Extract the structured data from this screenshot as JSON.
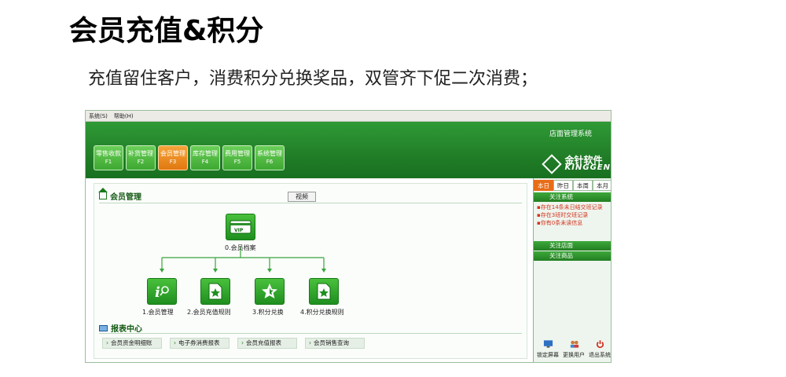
{
  "slide": {
    "title": "会员充值&积分",
    "subtitle": "充值留住客户，消费积分兑换奖品，双管齐下促二次消费；"
  },
  "app": {
    "menu": [
      "系统(S)",
      "帮助(H)"
    ],
    "system_title": "店面管理系统",
    "brand_cn": "金针软件",
    "brand_en": "KINGGEN",
    "nav": [
      {
        "label": "零售收款",
        "key": "F1"
      },
      {
        "label": "补货管理",
        "key": "F2"
      },
      {
        "label": "会员管理",
        "key": "F3"
      },
      {
        "label": "库存管理",
        "key": "F4"
      },
      {
        "label": "费用管理",
        "key": "F5"
      },
      {
        "label": "系统管理",
        "key": "F6"
      }
    ],
    "section_title": "会员管理",
    "video_label": "视频",
    "root_label": "0.会员档案",
    "root_icon_text": "VIP",
    "children": [
      {
        "label": "1.会员管理",
        "icon": "info-search-icon"
      },
      {
        "label": "2.会员充值规则",
        "icon": "star-document-icon"
      },
      {
        "label": "3.积分兑换",
        "icon": "star-icon"
      },
      {
        "label": "4.积分兑换规则",
        "icon": "star-document-icon"
      }
    ],
    "report_title": "报表中心",
    "reports": [
      "会员资金明细账",
      "电子券消费报表",
      "会员充值报表",
      "会员销售查询"
    ]
  },
  "side": {
    "tabs": [
      "本日",
      "昨日",
      "本周",
      "本月"
    ],
    "section1": "关注系统",
    "notices": [
      "▪存在14条未日结交班记录",
      "▪存在3班时交班记录",
      "▪你有0条未读信息"
    ],
    "section2": "关注店面",
    "section3": "关注商品",
    "actions": [
      {
        "label": "锁定屏幕",
        "icon": "lock-screen-icon",
        "color": "#2d6fc4"
      },
      {
        "label": "更换用户",
        "icon": "switch-user-icon",
        "color": "#3a8ad6"
      },
      {
        "label": "退出系统",
        "icon": "power-icon",
        "color": "#d42a1e"
      }
    ]
  },
  "colors": {
    "accent_green": "#2f9a36",
    "active_orange": "#e86d17",
    "notice_red": "#d4321e"
  }
}
